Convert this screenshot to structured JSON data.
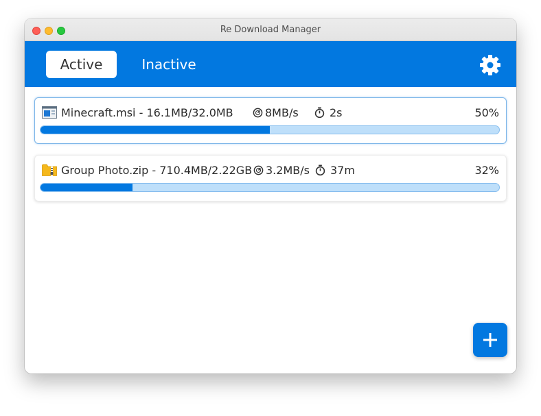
{
  "window": {
    "title": "Re Download Manager"
  },
  "tabs": [
    {
      "label": "Active",
      "selected": true
    },
    {
      "label": "Inactive",
      "selected": false
    }
  ],
  "settings_icon": "gear-icon",
  "downloads": [
    {
      "icon": "installer-file-icon",
      "name": "Minecraft.msi",
      "size_text": "16.1MB/32.0MB",
      "speed": "8MB/s",
      "time_left": "2s",
      "percent_text": "50%",
      "progress": 0.5,
      "selected": true
    },
    {
      "icon": "zip-folder-icon",
      "name": "Group Photo.zip",
      "size_text": "710.4MB/2.22GB",
      "speed": "3.2MB/s",
      "time_left": "37m",
      "percent_text": "32%",
      "progress": 0.2,
      "selected": false
    }
  ],
  "add_button": {
    "icon": "plus-icon"
  },
  "colors": {
    "accent": "#0278e0",
    "progress_track": "#bedffa"
  }
}
